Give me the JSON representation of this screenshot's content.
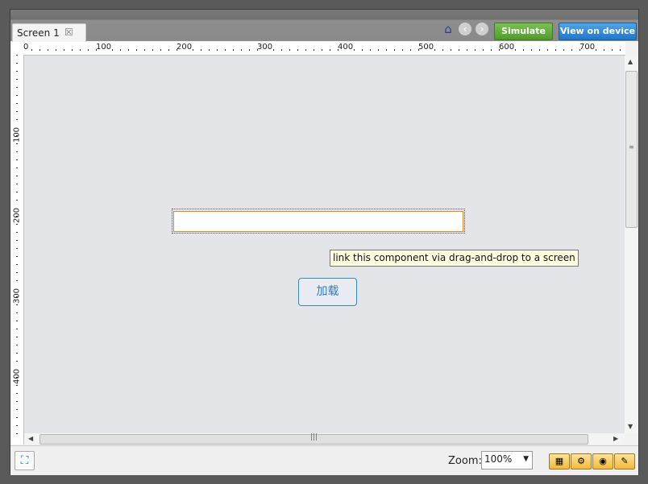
{
  "tabs": [
    {
      "label": "Screen 1"
    }
  ],
  "toolbar": {
    "simulate_label": "Simulate",
    "view_device_label": "View on device",
    "icons": [
      "home-icon",
      "back-icon",
      "forward-icon"
    ]
  },
  "ruler": {
    "horizontal_labels": [
      "0",
      "100",
      "200",
      "300",
      "400",
      "500",
      "600",
      "700"
    ],
    "vertical_labels": [
      "100",
      "200",
      "300",
      "400"
    ]
  },
  "canvas": {
    "textfield_value": "",
    "tooltip": "link this component via drag-and-drop to a screen",
    "button_label": "加载"
  },
  "bottombar": {
    "zoom_label": "Zoom:",
    "zoom_value": "100%",
    "tool_icons": [
      "layout-icon",
      "settings-icon",
      "preview-eye-icon",
      "comment-icon"
    ]
  },
  "colors": {
    "simulate": "#5aa832",
    "view_device": "#2a86d8",
    "canvas_bg": "#e3e5e9",
    "textfield_border": "#e08a2a",
    "button_border": "#3b87c9"
  }
}
